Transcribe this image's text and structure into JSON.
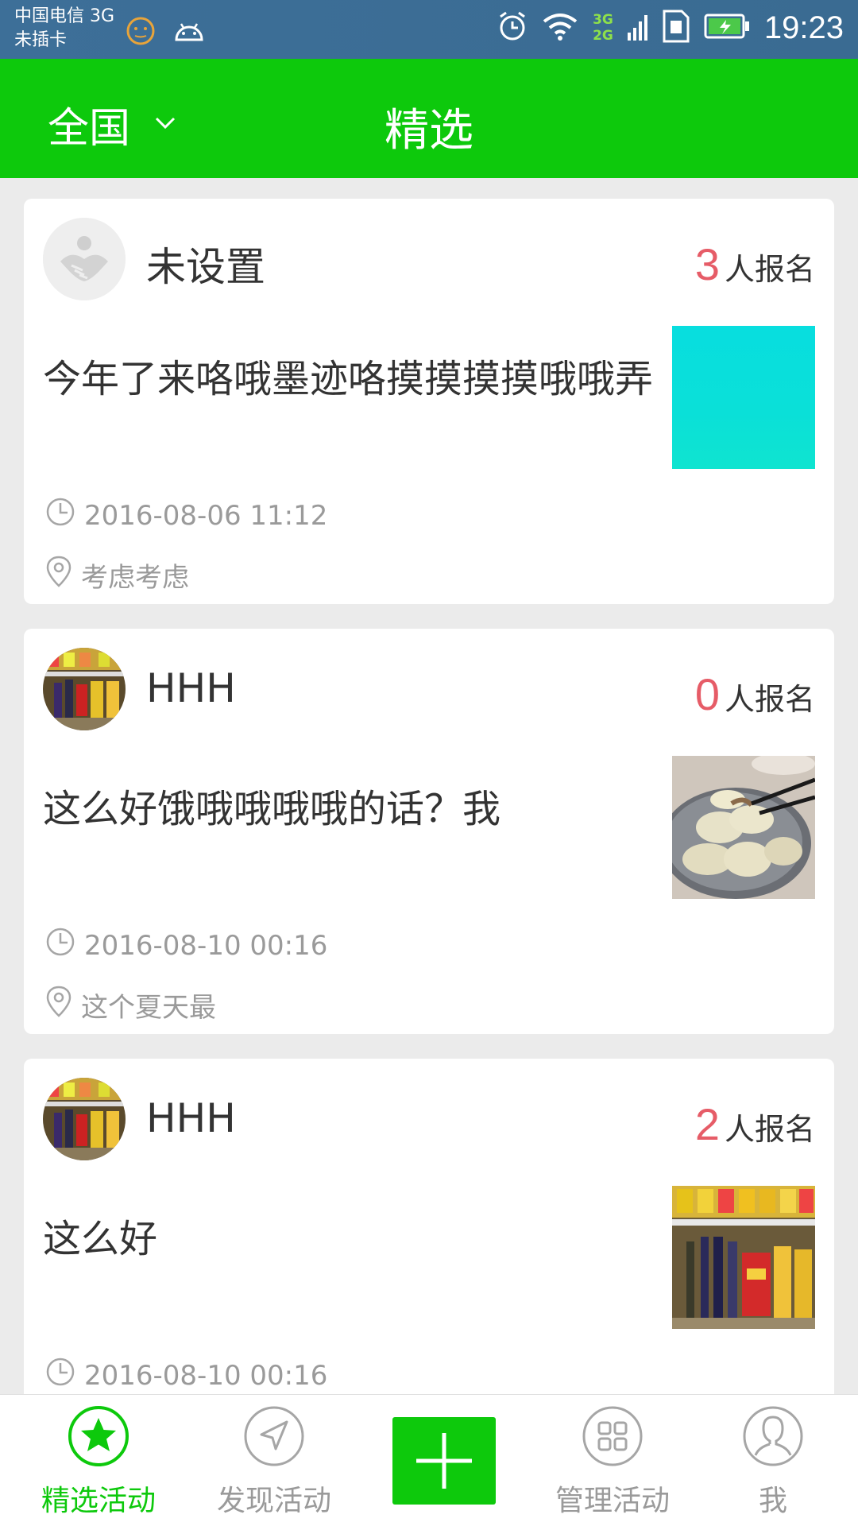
{
  "status_bar": {
    "carrier": "中国电信 3G",
    "sim": "未插卡",
    "net_top": "3G",
    "net_bottom": "2G",
    "time": "19:23"
  },
  "header": {
    "region": "全国",
    "title": "精选"
  },
  "feed": [
    {
      "username": "未设置",
      "signup_count": "3",
      "signup_label": "人报名",
      "title": "今年了来咯哦墨迹咯摸摸摸摸哦哦弄",
      "time": "2016-08-06 11:12",
      "location": "考虑考虑",
      "thumb": "cyan-image"
    },
    {
      "username": "HHH",
      "signup_count": "0",
      "signup_label": "人报名",
      "title": "这么好饿哦哦哦哦的话？我",
      "time": "2016-08-10 00:16",
      "location": "这个夏天最",
      "thumb": "dumplings-photo"
    },
    {
      "username": "HHH",
      "signup_count": "2",
      "signup_label": "人报名",
      "title": "这么好",
      "time": "2016-08-10 00:16",
      "location": "",
      "thumb": "shelf-photo"
    }
  ],
  "bottom_nav": {
    "featured": "精选活动",
    "discover": "发现活动",
    "manage": "管理活动",
    "me": "我"
  },
  "colors": {
    "primary": "#0dc90c",
    "count": "#e65c67",
    "statusbar": "#3d6f98"
  }
}
